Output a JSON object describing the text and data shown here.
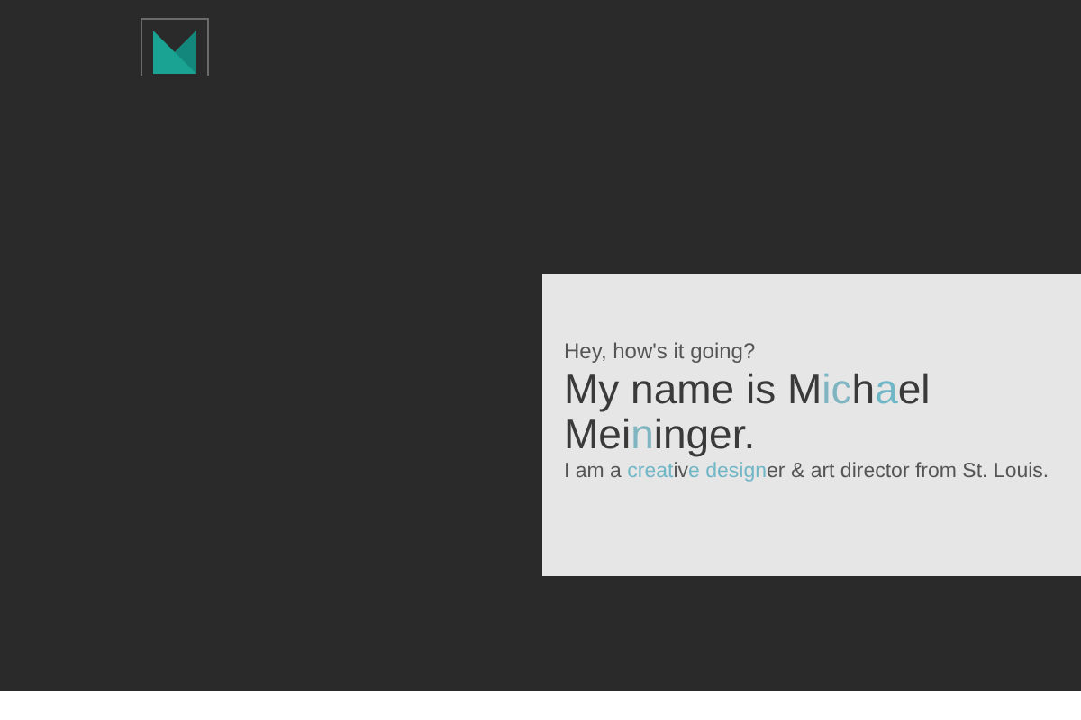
{
  "intro": {
    "greeting": "Hey, how's it going?",
    "heading": [
      {
        "text": "My name is M",
        "color": "#3a3a3a"
      },
      {
        "text": "ic",
        "color": "#7fb4c1"
      },
      {
        "text": "h",
        "color": "#3a3a3a"
      },
      {
        "text": "a",
        "color": "#6fb6c6"
      },
      {
        "text": "el Mei",
        "color": "#3a3a3a"
      },
      {
        "text": "n",
        "color": "#7fb4c1"
      },
      {
        "text": "inger.",
        "color": "#3a3a3a"
      }
    ],
    "tagline": [
      {
        "text": "I am a ",
        "color": "#555555"
      },
      {
        "text": "creat",
        "color": "#6fb6c6"
      },
      {
        "text": "iv",
        "color": "#555555"
      },
      {
        "text": "e design",
        "color": "#6fb6c6"
      },
      {
        "text": "er & art director from St. Louis.",
        "color": "#555555"
      }
    ]
  }
}
